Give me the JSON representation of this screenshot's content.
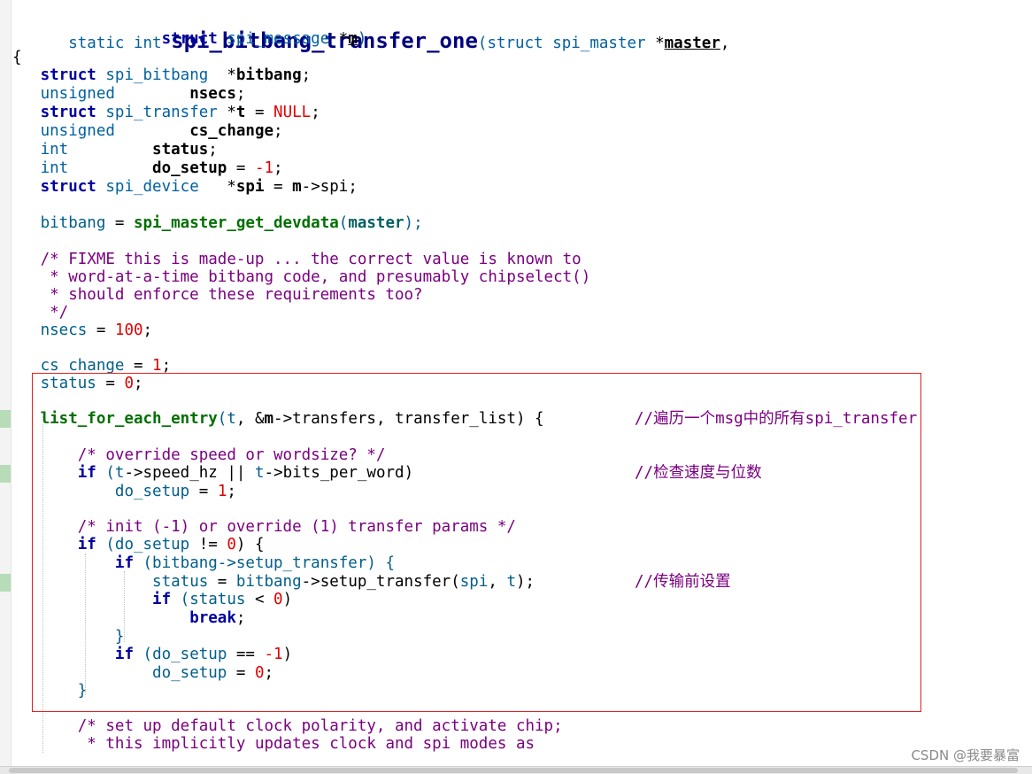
{
  "watermark": "CSDN @我要暴富",
  "code": {
    "sig_static": "static int ",
    "sig_name": "spi_bitbang_transfer_one",
    "sig_open": "(struct ",
    "sig_type1": "spi_master",
    "sig_star1": " *",
    "sig_param1": "master",
    "sig_comma": ",",
    "sig2_struct": "struct ",
    "sig2_type": "spi_message",
    "sig2_star": " *",
    "sig2_param": "m",
    "sig2_close": ")",
    "brace_open": "{",
    "d1_struct": "struct ",
    "d1_type": "spi_bitbang",
    "d1_star": "  *",
    "d1_name": "bitbang",
    "d1_semi": ";",
    "d2_type": "unsigned",
    "d2_name": "nsecs",
    "d2_semi": ";",
    "d3_struct": "struct ",
    "d3_type": "spi_transfer",
    "d3_star": " *",
    "d3_name": "t",
    "d3_eq": " = ",
    "d3_null": "NULL",
    "d3_semi": ";",
    "d4_type": "unsigned",
    "d4_name": "cs_change",
    "d4_semi": ";",
    "d5_type": "int",
    "d5_name": "status",
    "d5_semi": ";",
    "d6_type": "int",
    "d6_name": "do_setup",
    "d6_eq": " = ",
    "d6_val": "-1",
    "d6_semi": ";",
    "d7_struct": "struct ",
    "d7_type": "spi_device",
    "d7_star": "   *",
    "d7_name": "spi",
    "d7_eq": " = ",
    "d7_m": "m",
    "d7_rest": "->spi;",
    "a1_var": "bitbang",
    "a1_eq": " = ",
    "a1_fn": "spi_master_get_devdata",
    "a1_open": "(",
    "a1_arg": "master",
    "a1_close": ");",
    "c1": "/* FIXME this is made-up ... the correct value is known to",
    "c2": " * word-at-a-time bitbang code, and presumably chipselect()",
    "c3": " * should enforce these requirements too?",
    "c4": " */",
    "a2_var": "nsecs",
    "a2_eq": " = ",
    "a2_val": "100",
    "a2_semi": ";",
    "a3_var": "cs_change",
    "a3_eq": " = ",
    "a3_val": "1",
    "a3_semi": ";",
    "a4_var": "status",
    "a4_eq": " = ",
    "a4_val": "0",
    "a4_semi": ";",
    "l1_fn": "list_for_each_entry",
    "l1_open": "(",
    "l1_t": "t",
    "l1_amp": ", &",
    "l1_m": "m",
    "l1_rest": "->transfers, transfer_list) {",
    "l1_note": "//遍历一个msg中的所有spi_transfer",
    "c5": "/* override speed or wordsize? */",
    "i1_kw": "if",
    "i1_open": " (",
    "i1_t1": "t",
    "i1_mid": "->speed_hz || ",
    "i1_t2": "t",
    "i1_rest": "->bits_per_word)",
    "i1_note": "//检查速度与位数",
    "s1_var": "do_setup",
    "s1_eq": " = ",
    "s1_val": "1",
    "s1_semi": ";",
    "c6": "/* init (-1) or override (1) transfer params */",
    "i2_kw": "if",
    "i2_open": " (",
    "i2_var": "do_setup",
    "i2_op": " != ",
    "i2_val": "0",
    "i2_close": ") {",
    "i3_kw": "if",
    "i3_rest": " (bitbang->setup_transfer) {",
    "s2_var": "status",
    "s2_eq": " = ",
    "s2_obj": "bitbang",
    "s2_call": "->setup_transfer(",
    "s2_spi": "spi",
    "s2_comma": ", ",
    "s2_t": "t",
    "s2_close": ");",
    "s2_note": "//传输前设置",
    "i4_kw": "if",
    "i4_open": " (",
    "i4_var": "status",
    "i4_op": " < ",
    "i4_val": "0",
    "i4_close": ")",
    "brk_kw": "break",
    "brk_semi": ";",
    "close_inner": "}",
    "i5_kw": "if",
    "i5_open": " (",
    "i5_var": "do_setup",
    "i5_op": " == ",
    "i5_val": "-1",
    "i5_close": ")",
    "s3_var": "do_setup",
    "s3_eq": " = ",
    "s3_val": "0",
    "s3_semi": ";",
    "close_outer": "}",
    "c7": "/* set up default clock polarity, and activate chip;",
    "c8": " * this implicitly updates clock and spi modes as"
  }
}
